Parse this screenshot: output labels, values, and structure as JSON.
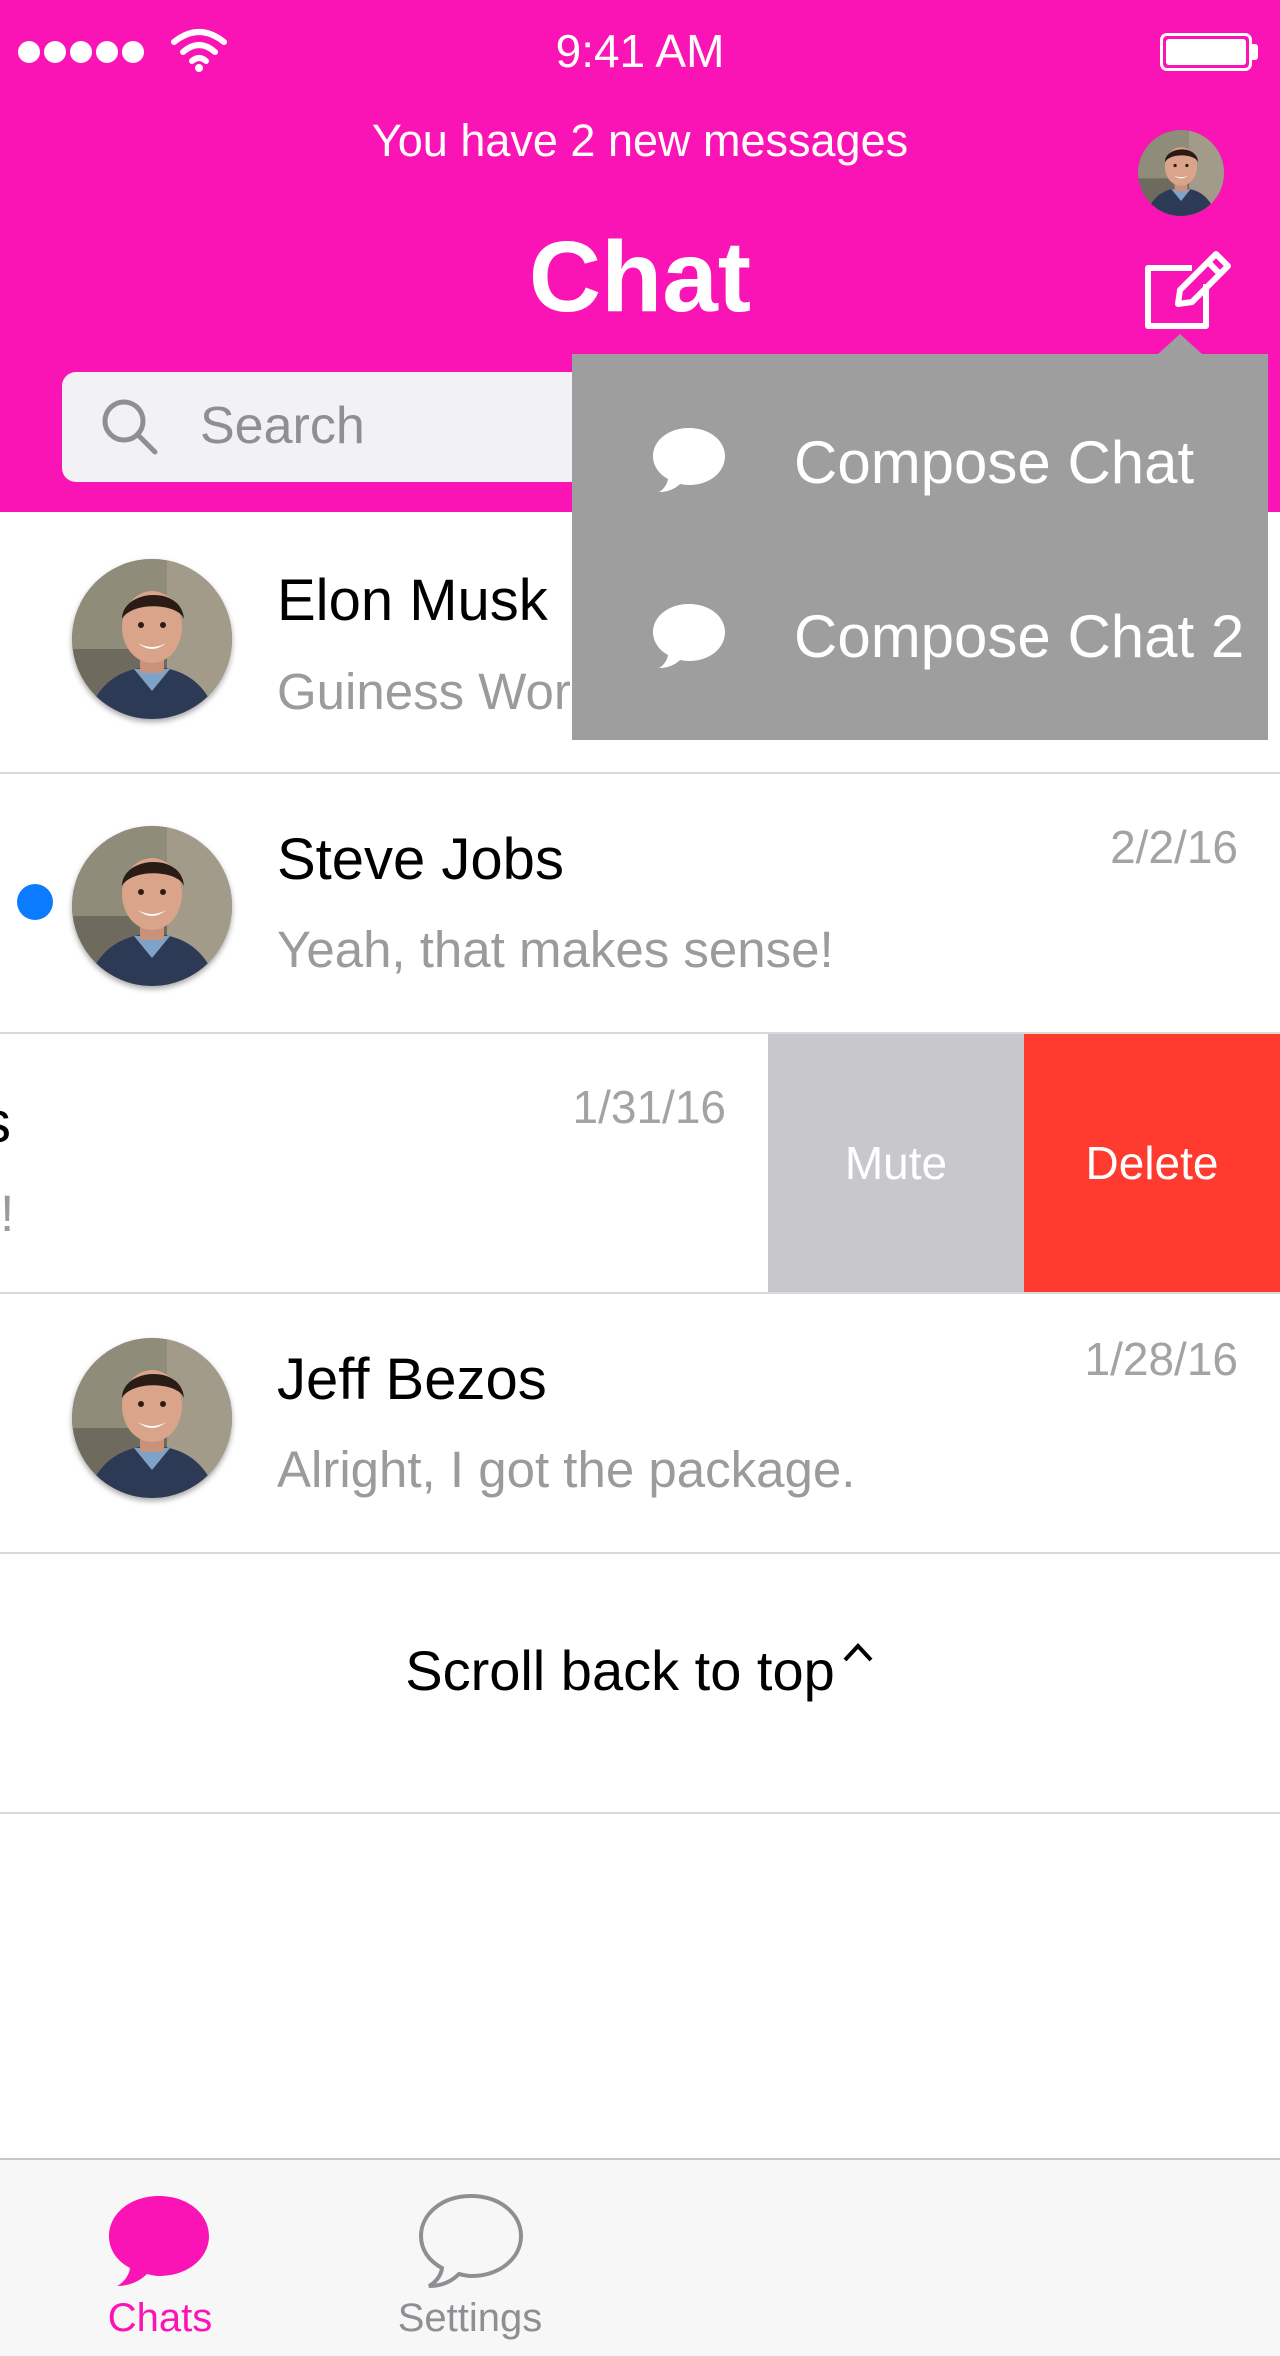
{
  "status_bar": {
    "time": "9:41 AM",
    "signal_dots": 5
  },
  "header": {
    "banner": "You have 2 new messages",
    "title": "Chat",
    "background_color": "#fb14b5"
  },
  "search": {
    "placeholder": "Search"
  },
  "dropdown": {
    "items": [
      {
        "label": "Compose Chat",
        "icon": "speech-bubble-icon"
      },
      {
        "label": "Compose Chat 2",
        "icon": "speech-bubble-icon"
      }
    ]
  },
  "chats": [
    {
      "name": "Elon Musk",
      "preview": "Guiness Wor",
      "date": ""
    },
    {
      "name": "Steve Jobs",
      "preview": "Yeah, that makes sense!",
      "date": "2/2/16",
      "unread": true
    },
    {
      "name": "s",
      "preview": "t!",
      "date": "1/31/16"
    },
    {
      "name": "Jeff Bezos",
      "preview": "Alright, I got the package.",
      "date": "1/28/16"
    }
  ],
  "swipe_actions": {
    "mute": "Mute",
    "delete": "Delete"
  },
  "scroll_top": {
    "label": "Scroll back to top",
    "icon": "chevron-up-icon"
  },
  "tab_bar": {
    "tabs": [
      {
        "label": "Chats",
        "icon": "chat-bubble-icon",
        "active": true
      },
      {
        "label": "Settings",
        "icon": "chat-bubble-outline-icon",
        "active": false
      }
    ],
    "active_color": "#fb14b5",
    "inactive_color": "#8e8e93"
  },
  "colors": {
    "unread_dot": "#0b7cff",
    "delete": "#ff3b2f",
    "mute": "#c7c7cc"
  }
}
